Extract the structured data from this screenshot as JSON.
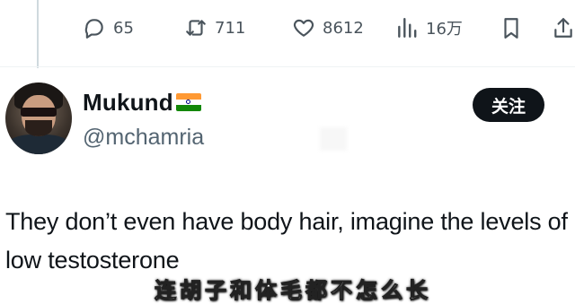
{
  "actions": {
    "reply_count": "65",
    "repost_count": "711",
    "like_count": "8612",
    "views_count": "16万"
  },
  "icons": {
    "reply": "reply-bubble-icon",
    "repost": "repost-icon",
    "like": "heart-icon",
    "views": "bar-chart-icon",
    "bookmark": "bookmark-icon",
    "share": "share-icon"
  },
  "author": {
    "name": "Mukund",
    "handle": "@mchamria",
    "flag": "india-flag-emoji"
  },
  "follow_button": {
    "label": "关注"
  },
  "tweet": {
    "text": "They don’t even have body hair, imagine the levels of low testosterone"
  },
  "video_subtitle": "连胡子和体毛都不怎么长",
  "colors": {
    "text_primary": "#0f1419",
    "text_secondary": "#536471",
    "button_bg": "#0f1419",
    "button_text": "#ffffff"
  }
}
